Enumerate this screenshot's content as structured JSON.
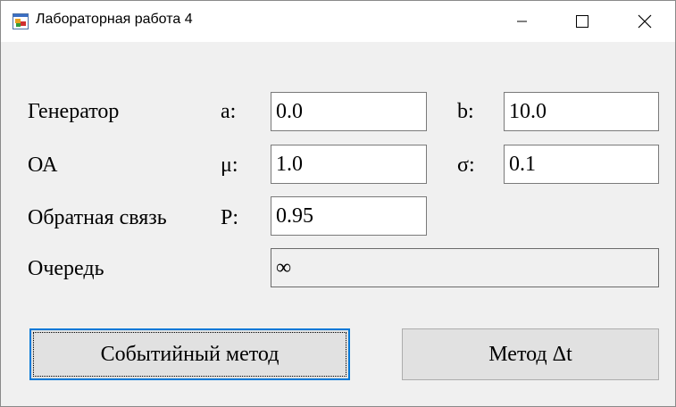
{
  "window": {
    "title": "Лабораторная работа 4",
    "icon": "app-form-icon",
    "controls": {
      "minimize": "minimize-icon",
      "maximize": "maximize-icon",
      "close": "close-icon"
    }
  },
  "form": {
    "generator": {
      "label": "Генератор",
      "a_label": "a:",
      "a_value": "0.0",
      "b_label": "b:",
      "b_value": "10.0"
    },
    "oa": {
      "label": "ОА",
      "mu_label": "μ:",
      "mu_value": "1.0",
      "sigma_label": "σ:",
      "sigma_value": "0.1"
    },
    "feedback": {
      "label": "Обратная связь",
      "p_label": "P:",
      "p_value": "0.95"
    },
    "queue": {
      "label": "Очередь",
      "value": "∞"
    }
  },
  "buttons": {
    "event_method": "Событийный метод",
    "delta_t_method": "Метод Δt"
  },
  "colors": {
    "window_bg": "#f0f0f0",
    "titlebar_bg": "#ffffff",
    "focus_border": "#0078d7",
    "button_bg": "#e1e1e1"
  }
}
